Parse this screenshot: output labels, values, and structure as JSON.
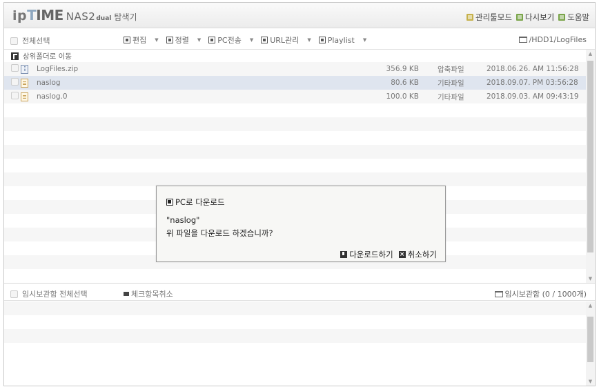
{
  "header": {
    "logo_ip": "ip",
    "logo_time_t": "T",
    "logo_time_rest": "IME",
    "logo_model": "NAS2",
    "logo_dual": "dual",
    "app_title": "탐색기",
    "menu": [
      {
        "label": "관리툴모드",
        "icon": "admin-tool-icon"
      },
      {
        "label": "다시보기",
        "icon": "refresh-icon"
      },
      {
        "label": "도움말",
        "icon": "help-icon"
      }
    ]
  },
  "toolbar": {
    "select_all": "전체선택",
    "items": [
      {
        "label": "편집",
        "icon": "edit-icon"
      },
      {
        "label": "정렬",
        "icon": "sort-icon"
      },
      {
        "label": "PC전송",
        "icon": "pc-transfer-icon"
      },
      {
        "label": "URL관리",
        "icon": "url-manage-icon"
      },
      {
        "label": "Playlist",
        "icon": "playlist-icon"
      }
    ],
    "path": "/HDD1/LogFiles"
  },
  "filelist": {
    "up_label": "상위폴더로 이동",
    "files": [
      {
        "name": "LogFiles.zip",
        "size": "356.9 KB",
        "type": "압축파일",
        "date": "2018.06.26. AM 11:56:28",
        "icon": "zip-file-icon"
      },
      {
        "name": "naslog",
        "size": "80.6 KB",
        "type": "기타파일",
        "date": "2018.09.07. PM 03:56:28",
        "icon": "text-file-icon"
      },
      {
        "name": "naslog.0",
        "size": "100.0 KB",
        "type": "기타파일",
        "date": "2018.09.03. AM 09:43:19",
        "icon": "text-file-icon"
      }
    ]
  },
  "bottom": {
    "temp_select_all": "임시보관함 전체선택",
    "clear_checked": "체크항목취소",
    "temp_box": "임시보관함 (0 / 1000개)"
  },
  "dialog": {
    "title": "PC로 다운로드",
    "filename": "\"naslog\"",
    "message": "위 파일을 다운로드 하겠습니까?",
    "download_button": "다운로드하기",
    "cancel_button": "취소하기"
  },
  "colors": {
    "selected_row": "#dfe5ef",
    "alt_row": "#f6f6f6",
    "menu_icon_yellow": "#c6b14b",
    "menu_icon_green": "#7aa54a"
  }
}
